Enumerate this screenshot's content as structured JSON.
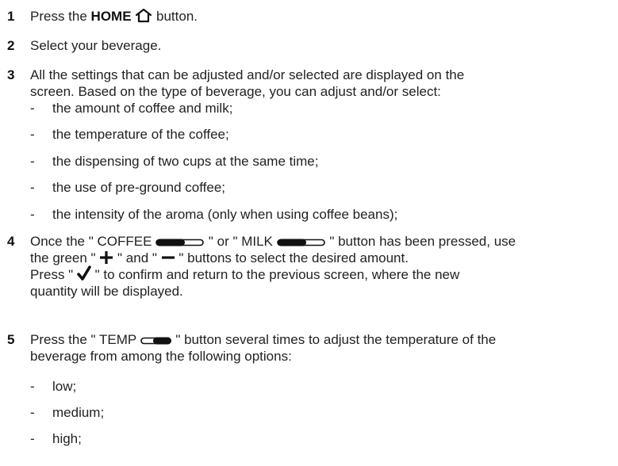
{
  "steps": [
    {
      "num": "1",
      "pre": "Press the ",
      "bold": "HOME",
      "post": " button.",
      "icon": "home-icon"
    },
    {
      "num": "2",
      "text": "Select your beverage."
    },
    {
      "num": "3",
      "line1": "All the settings that can be adjusted and/or selected are displayed on the",
      "line2": "screen. Based on the type of beverage, you can adjust and/or select:",
      "items": [
        "the amount of coffee and milk;",
        "the temperature of the coffee;",
        "the dispensing of two cups at the same time;",
        "the use of pre-ground coffee;",
        "the intensity of the aroma (only when using coffee beans);"
      ]
    },
    {
      "num": "4",
      "l1_a": "Once the \" COFFEE ",
      "l1_b": " \" or \" MILK ",
      "l1_c": " \" button has been pressed, use",
      "l2_a": "the green \" ",
      "l2_b": " \" and \" ",
      "l2_c": " \" buttons to select the desired amount.",
      "l3_a": "Press \" ",
      "l3_b": " \" to confirm and return to the previous screen, where the new",
      "l4": "quantity will be displayed."
    },
    {
      "num": "5",
      "l1_a": "Press the \" TEMP ",
      "l1_b": " \" button several times to adjust the temperature of the",
      "l2": "beverage from among the following options:",
      "items": [
        "low;",
        "medium;",
        "high;"
      ]
    }
  ],
  "dash": "-",
  "icons": [
    "home-icon",
    "slider-filled-icon",
    "plus-icon",
    "minus-icon",
    "check-icon",
    "slider-outline-icon"
  ],
  "colors": {
    "text": "#222222",
    "icon": "#111111"
  }
}
